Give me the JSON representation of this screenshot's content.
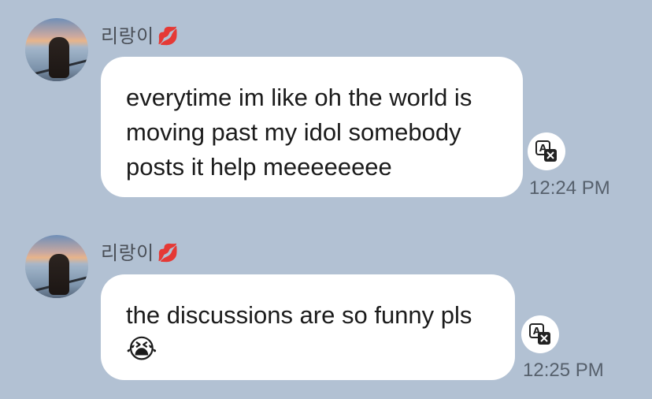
{
  "messages": [
    {
      "sender": "리랑이",
      "sender_emoji": "💋",
      "lines": [
        "everytime im like oh the world is",
        "moving past my idol somebody",
        "posts it help meeeeeeee"
      ],
      "time": "12:24 PM"
    },
    {
      "sender": "리랑이",
      "sender_emoji": "💋",
      "lines": [
        "the discussions are so funny pls",
        "😭"
      ],
      "time": "12:25 PM"
    }
  ],
  "icons": {
    "translate": "translate-icon",
    "reaction": "kiss-mark-icon"
  },
  "colors": {
    "background": "#b2c1d3",
    "bubble": "#ffffff",
    "text": "#1b1b1b",
    "timestamp": "#56606c"
  }
}
